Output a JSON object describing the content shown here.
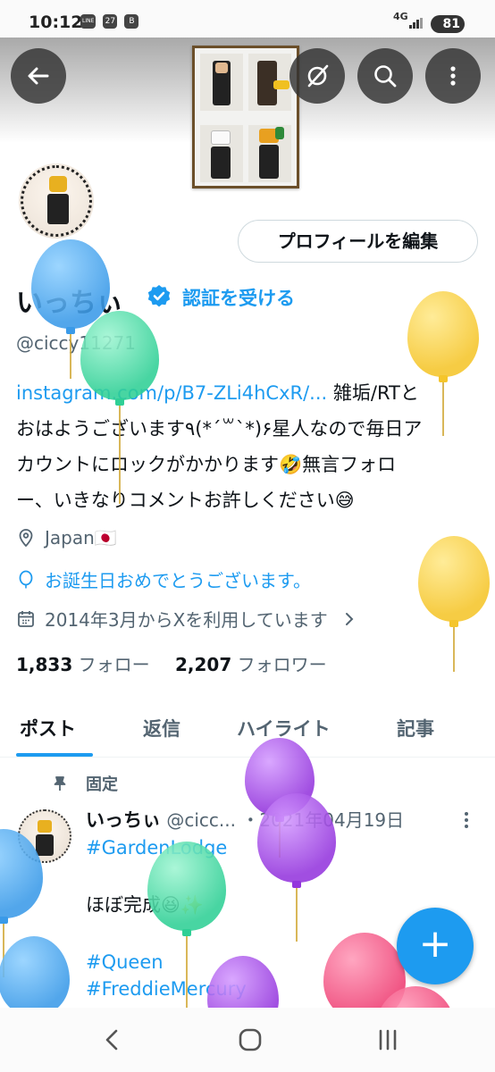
{
  "status_bar": {
    "time": "10:12",
    "badges": [
      "LINE",
      "27",
      "B"
    ],
    "network": "4G",
    "battery": "81"
  },
  "header": {
    "back_icon": "arrow-left-icon",
    "buttons": [
      "eye-off-icon",
      "search-icon",
      "more-vertical-icon"
    ]
  },
  "profile": {
    "edit_button": "プロフィールを編集",
    "display_name": "いっちぃ",
    "verify_link": "認証を受ける",
    "handle": "@ciccy11271",
    "bio_link": "instagram.com/p/B7-ZLi4hCxR/...",
    "bio_line1_rest": " 雑垢/RTと",
    "bio_line2": "おはようございます٩(*´꒳`*)۶星人なので毎日ア",
    "bio_line3": "カウントにロックがかかります🤣無言フォロ",
    "bio_line4": "ー、いきなりコメントお許しください😅",
    "location": "Japan🇯🇵",
    "birthday": "お誕生日おめでとうございます。",
    "joined": "2014年3月からXを利用しています",
    "following_count": "1,833",
    "following_label": "フォロー",
    "followers_count": "2,207",
    "followers_label": "フォロワー"
  },
  "tabs": [
    {
      "label": "ポスト",
      "active": true
    },
    {
      "label": "返信",
      "active": false
    },
    {
      "label": "ハイライト",
      "active": false
    },
    {
      "label": "記事",
      "active": false
    }
  ],
  "post": {
    "pinned_label": "固定",
    "author": "いっちぃ",
    "handle_trunc": "@cicc...",
    "date": "・2021年04月19日",
    "tag1": "#GardenLodge",
    "text": "ほぼ完成😆✨",
    "tag2": "#Queen",
    "tag3": "#FreddieMercury"
  },
  "fab_label": "+",
  "colors": {
    "accent": "#1d9bf0",
    "balloon_blue": "#4aa8f0",
    "balloon_green": "#3ed6a0",
    "balloon_yellow": "#f7cc2e",
    "balloon_purple": "#9b3fe0",
    "balloon_pink": "#f0457a"
  }
}
